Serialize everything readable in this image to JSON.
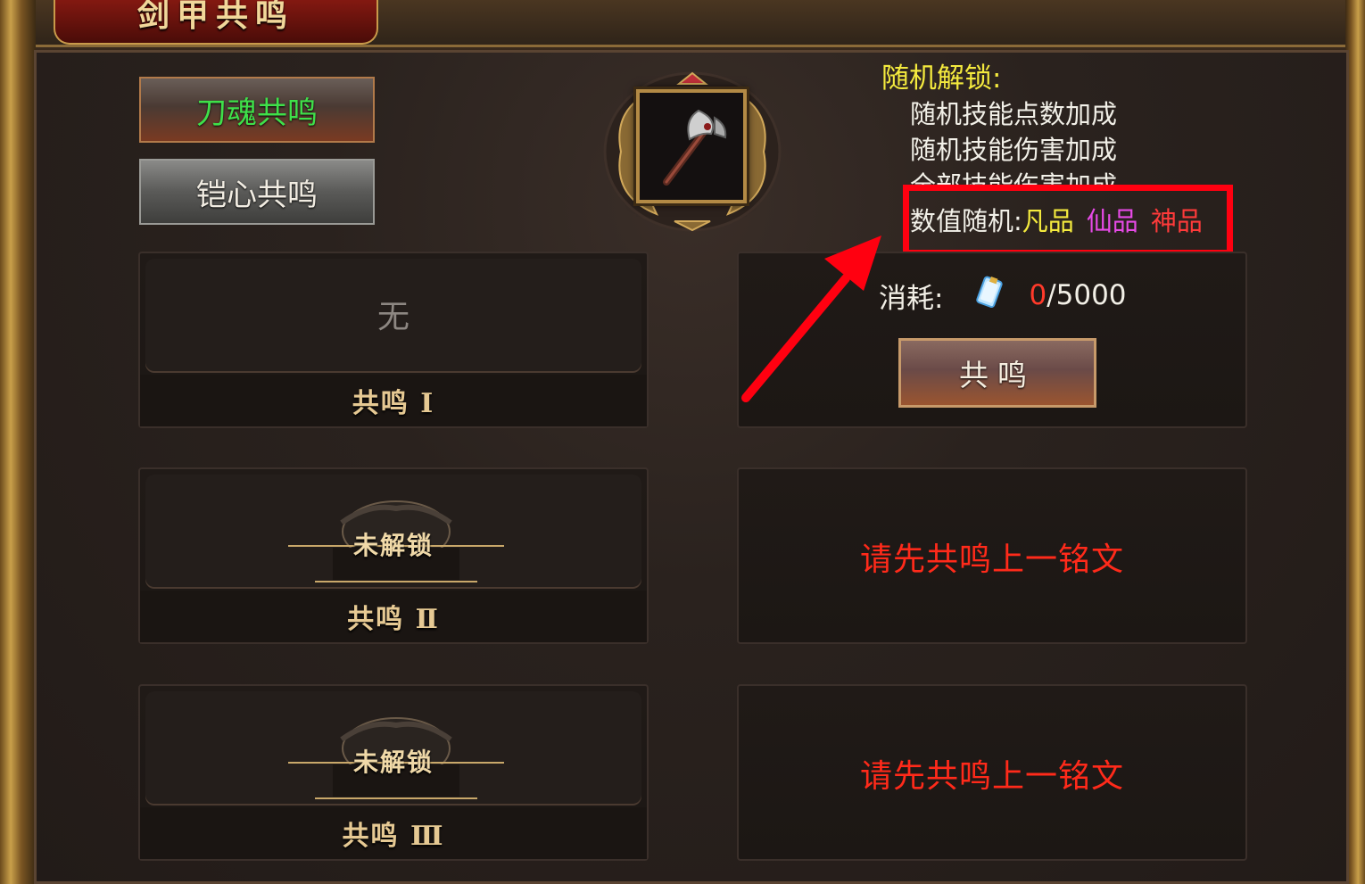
{
  "window": {
    "title": "剑甲共鸣"
  },
  "tabs": [
    {
      "label": "刀魂共鸣",
      "active": true
    },
    {
      "label": "铠心共鸣",
      "active": false
    }
  ],
  "equipped_item": {
    "icon": "axe-icon"
  },
  "unlock_info": {
    "title": "随机解锁:",
    "lines": [
      "随机技能点数加成",
      "随机技能伤害加成",
      "全部技能伤害加成"
    ],
    "random_label": "数值随机:",
    "qualities": [
      {
        "label": "凡品",
        "color": "#f4ea3e"
      },
      {
        "label": "仙品",
        "color": "#e64ae6"
      },
      {
        "label": "神品",
        "color": "#ff3a3a"
      }
    ]
  },
  "slots": [
    {
      "status": "无",
      "label": "共鸣 Ⅰ"
    },
    {
      "status": "未解锁",
      "label": "共鸣 Ⅱ"
    },
    {
      "status": "未解锁",
      "label": "共鸣 Ⅲ"
    }
  ],
  "cost": {
    "label": "消耗:",
    "icon": "scroll-icon",
    "have": "0",
    "need": "/5000"
  },
  "resonate_button": {
    "label": "共鸣"
  },
  "locked_prompts": [
    "请先共鸣上一铭文",
    "请先共鸣上一铭文"
  ],
  "colors": {
    "active_tab_text": "#3fe04a",
    "warning_red": "#ff2a1a",
    "highlight_box": "#ff0010"
  }
}
